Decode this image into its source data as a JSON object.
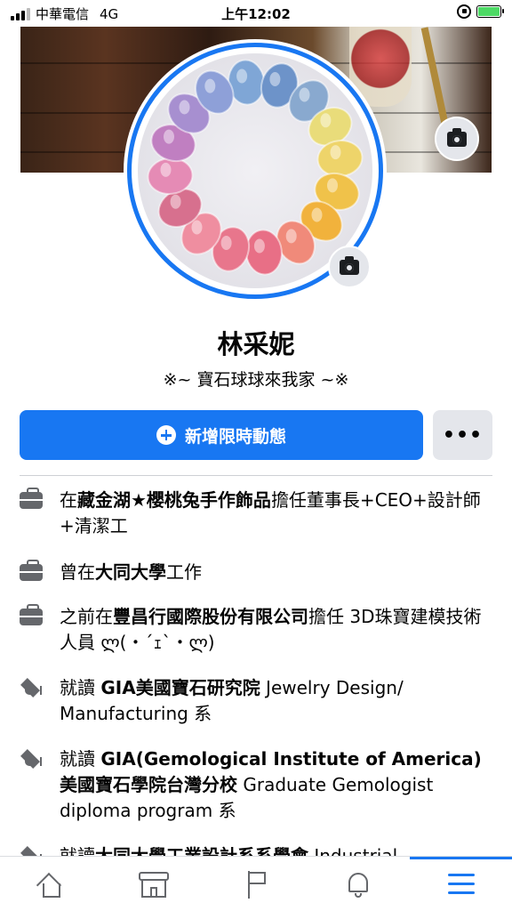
{
  "status_bar": {
    "carrier": "中華電信",
    "network": "4G",
    "time": "上午12:02"
  },
  "profile": {
    "name": "林采妮",
    "bio": "※~ 寶石球球來我家 ~※"
  },
  "actions": {
    "add_story_label": "新增限時動態",
    "more_label": "•••"
  },
  "info": [
    {
      "icon": "briefcase-icon",
      "parts": [
        [
          "在",
          false
        ],
        [
          "藏金湖★櫻桃兔手作飾品",
          true
        ],
        [
          "擔任董事長+CEO+設計師+清潔工",
          false
        ]
      ]
    },
    {
      "icon": "briefcase-icon",
      "parts": [
        [
          "曾在",
          false
        ],
        [
          "大同大學",
          true
        ],
        [
          "工作",
          false
        ]
      ]
    },
    {
      "icon": "briefcase-icon",
      "parts": [
        [
          "之前在",
          false
        ],
        [
          "豐昌行國際股份有限公司",
          true
        ],
        [
          "擔任 3D珠寶建模技術人員 ლ(・´ｪ`・ლ)",
          false
        ]
      ]
    },
    {
      "icon": "graduation-cap-icon",
      "parts": [
        [
          "就讀 ",
          false
        ],
        [
          "GIA美國寶石研究院",
          true
        ],
        [
          " Jewelry Design/ Manufacturing 系",
          false
        ]
      ]
    },
    {
      "icon": "graduation-cap-icon",
      "parts": [
        [
          "就讀 ",
          false
        ],
        [
          "GIA(Gemological Institute of America)美國寶石學院台灣分校",
          true
        ],
        [
          " Graduate Gemologist diploma program 系",
          false
        ]
      ]
    },
    {
      "icon": "graduation-cap-icon",
      "parts": [
        [
          "就讀",
          false
        ],
        [
          "大同大學工業設計系系學會",
          true
        ],
        [
          " Industrial",
          false
        ]
      ]
    }
  ],
  "nav": [
    {
      "name": "home",
      "icon": "home-icon"
    },
    {
      "name": "marketplace",
      "icon": "store-icon"
    },
    {
      "name": "pages",
      "icon": "flag-icon"
    },
    {
      "name": "notifications",
      "icon": "bell-icon"
    },
    {
      "name": "menu",
      "icon": "menu-icon"
    }
  ],
  "colors": {
    "accent": "#1877f2",
    "secondary_button": "#e4e6eb",
    "icon_gray": "#65676b",
    "battery": "#4cd964"
  }
}
